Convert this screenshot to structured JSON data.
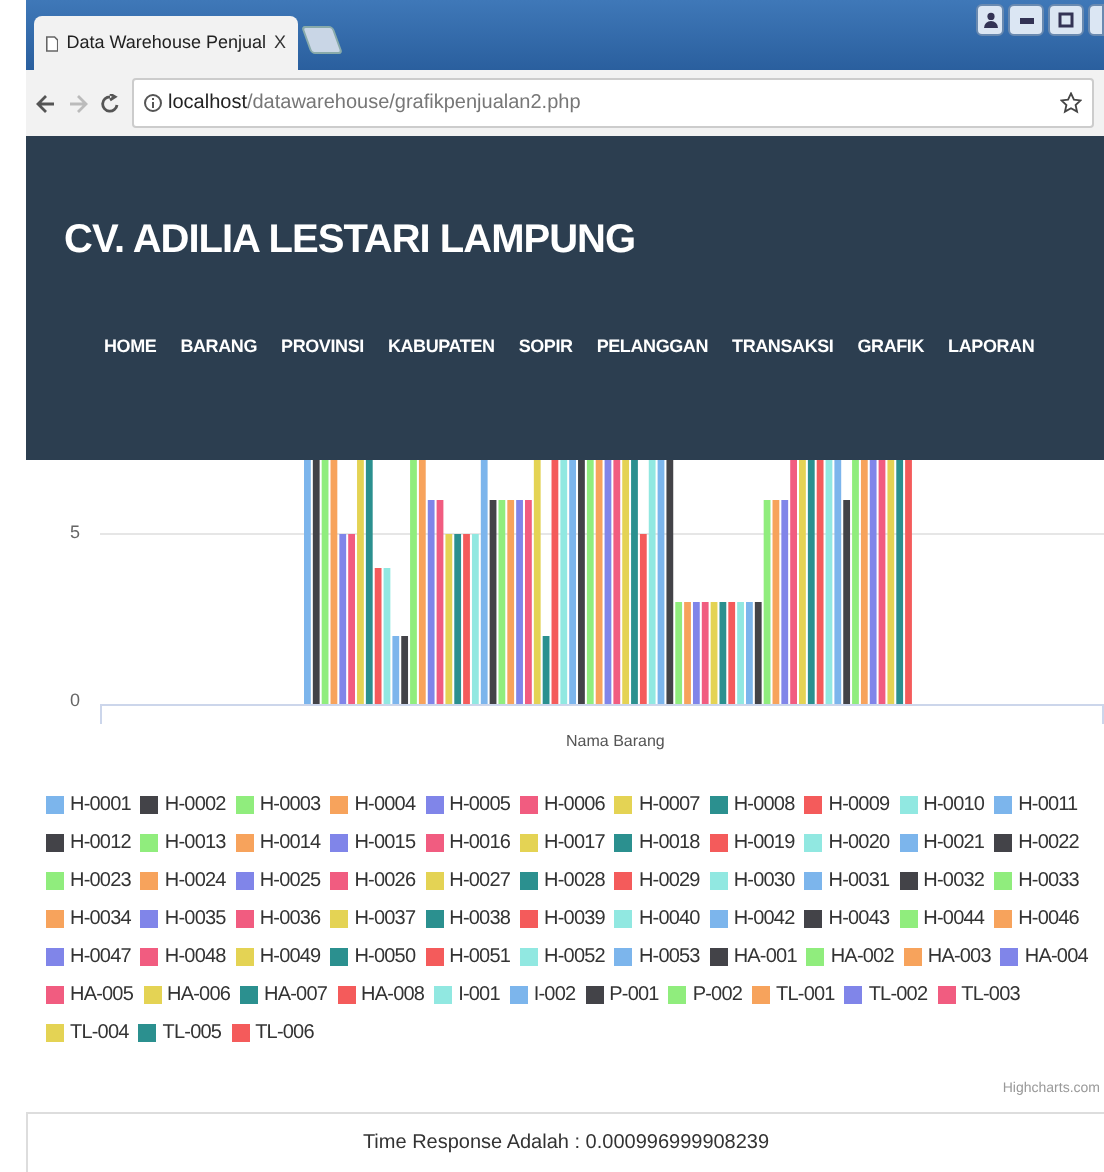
{
  "browser": {
    "tab": {
      "title": "Data Warehouse Penjual",
      "close": "X"
    },
    "address": {
      "host": "localhost",
      "path": "/datawarehouse/grafikpenjualan2.php"
    },
    "forward_disabled": true
  },
  "header": {
    "title": "CV. ADILIA LESTARI LAMPUNG",
    "nav": [
      "HOME",
      "BARANG",
      "PROVINSI",
      "KABUPATEN",
      "SOPIR",
      "PELANGGAN",
      "TRANSAKSI",
      "GRAFIK",
      "LAPORAN"
    ]
  },
  "chart": {
    "yticks": [
      "5",
      "0"
    ],
    "xlabel": "Nama Barang",
    "credit": "Highcharts.com",
    "legend": [
      {
        "label": "H-0001",
        "color": "#7cb5ec"
      },
      {
        "label": "H-0002",
        "color": "#434348"
      },
      {
        "label": "H-0003",
        "color": "#90ed7d"
      },
      {
        "label": "H-0004",
        "color": "#f7a35c"
      },
      {
        "label": "H-0005",
        "color": "#8085e9"
      },
      {
        "label": "H-0006",
        "color": "#f15c80"
      },
      {
        "label": "H-0007",
        "color": "#e4d354"
      },
      {
        "label": "H-0008",
        "color": "#2b908f"
      },
      {
        "label": "H-0009",
        "color": "#f45b5b"
      },
      {
        "label": "H-0010",
        "color": "#91e8e1"
      },
      {
        "label": "H-0011",
        "color": "#7cb5ec"
      },
      {
        "label": "H-0012",
        "color": "#434348"
      },
      {
        "label": "H-0013",
        "color": "#90ed7d"
      },
      {
        "label": "H-0014",
        "color": "#f7a35c"
      },
      {
        "label": "H-0015",
        "color": "#8085e9"
      },
      {
        "label": "H-0016",
        "color": "#f15c80"
      },
      {
        "label": "H-0017",
        "color": "#e4d354"
      },
      {
        "label": "H-0018",
        "color": "#2b908f"
      },
      {
        "label": "H-0019",
        "color": "#f45b5b"
      },
      {
        "label": "H-0020",
        "color": "#91e8e1"
      },
      {
        "label": "H-0021",
        "color": "#7cb5ec"
      },
      {
        "label": "H-0022",
        "color": "#434348"
      },
      {
        "label": "H-0023",
        "color": "#90ed7d"
      },
      {
        "label": "H-0024",
        "color": "#f7a35c"
      },
      {
        "label": "H-0025",
        "color": "#8085e9"
      },
      {
        "label": "H-0026",
        "color": "#f15c80"
      },
      {
        "label": "H-0027",
        "color": "#e4d354"
      },
      {
        "label": "H-0028",
        "color": "#2b908f"
      },
      {
        "label": "H-0029",
        "color": "#f45b5b"
      },
      {
        "label": "H-0030",
        "color": "#91e8e1"
      },
      {
        "label": "H-0031",
        "color": "#7cb5ec"
      },
      {
        "label": "H-0032",
        "color": "#434348"
      },
      {
        "label": "H-0033",
        "color": "#90ed7d"
      },
      {
        "label": "H-0034",
        "color": "#f7a35c"
      },
      {
        "label": "H-0035",
        "color": "#8085e9"
      },
      {
        "label": "H-0036",
        "color": "#f15c80"
      },
      {
        "label": "H-0037",
        "color": "#e4d354"
      },
      {
        "label": "H-0038",
        "color": "#2b908f"
      },
      {
        "label": "H-0039",
        "color": "#f45b5b"
      },
      {
        "label": "H-0040",
        "color": "#91e8e1"
      },
      {
        "label": "H-0042",
        "color": "#7cb5ec"
      },
      {
        "label": "H-0043",
        "color": "#434348"
      },
      {
        "label": "H-0044",
        "color": "#90ed7d"
      },
      {
        "label": "H-0046",
        "color": "#f7a35c"
      },
      {
        "label": "H-0047",
        "color": "#8085e9"
      },
      {
        "label": "H-0048",
        "color": "#f15c80"
      },
      {
        "label": "H-0049",
        "color": "#e4d354"
      },
      {
        "label": "H-0050",
        "color": "#2b908f"
      },
      {
        "label": "H-0051",
        "color": "#f45b5b"
      },
      {
        "label": "H-0052",
        "color": "#91e8e1"
      },
      {
        "label": "H-0053",
        "color": "#7cb5ec"
      },
      {
        "label": "HA-001",
        "color": "#434348"
      },
      {
        "label": "HA-002",
        "color": "#90ed7d"
      },
      {
        "label": "HA-003",
        "color": "#f7a35c"
      },
      {
        "label": "HA-004",
        "color": "#8085e9"
      },
      {
        "label": "HA-005",
        "color": "#f15c80"
      },
      {
        "label": "HA-006",
        "color": "#e4d354"
      },
      {
        "label": "HA-007",
        "color": "#2b908f"
      },
      {
        "label": "HA-008",
        "color": "#f45b5b"
      },
      {
        "label": "I-001",
        "color": "#91e8e1"
      },
      {
        "label": "I-002",
        "color": "#7cb5ec"
      },
      {
        "label": "P-001",
        "color": "#434348"
      },
      {
        "label": "P-002",
        "color": "#90ed7d"
      },
      {
        "label": "TL-001",
        "color": "#f7a35c"
      },
      {
        "label": "TL-002",
        "color": "#8085e9"
      },
      {
        "label": "TL-003",
        "color": "#f15c80"
      },
      {
        "label": "TL-004",
        "color": "#e4d354"
      },
      {
        "label": "TL-005",
        "color": "#2b908f"
      },
      {
        "label": "TL-006",
        "color": "#f45b5b"
      }
    ]
  },
  "footer": {
    "text": "Time Response Adalah : 0.000996999908239"
  }
}
